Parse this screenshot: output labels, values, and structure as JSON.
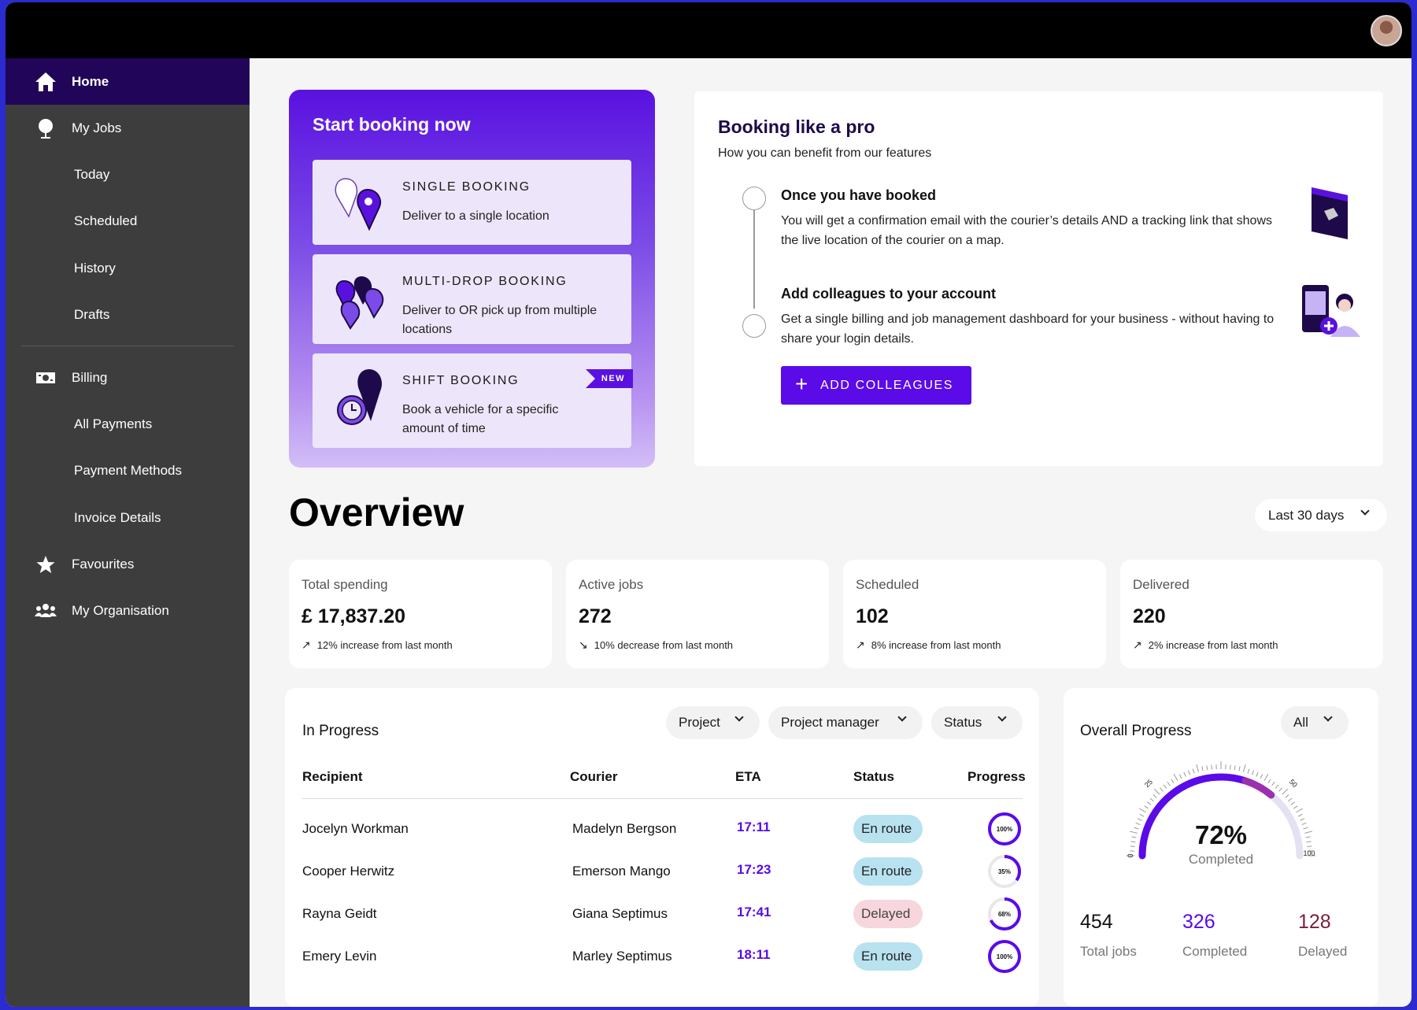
{
  "sidebar": {
    "items": [
      {
        "label": "Home",
        "icon": "home-icon"
      },
      {
        "label": "My Jobs",
        "icon": "map-pin-icon"
      },
      {
        "label": "Today"
      },
      {
        "label": "Scheduled"
      },
      {
        "label": "History"
      },
      {
        "label": "Drafts"
      },
      {
        "label": "Billing",
        "icon": "banknote-icon"
      },
      {
        "label": "All Payments"
      },
      {
        "label": "Payment Methods"
      },
      {
        "label": "Invoice Details"
      },
      {
        "label": "Favourites",
        "icon": "star-icon"
      },
      {
        "label": "My Organisation",
        "icon": "people-icon"
      }
    ]
  },
  "booking": {
    "title": "Start booking now",
    "options": [
      {
        "title": "SINGLE BOOKING",
        "desc": "Deliver to a single location"
      },
      {
        "title": "MULTI-DROP BOOKING",
        "desc": "Deliver to OR pick up from multiple locations"
      },
      {
        "title": "SHIFT BOOKING",
        "desc": "Book a vehicle for a specific amount of time",
        "badge": "NEW"
      }
    ]
  },
  "pro": {
    "title": "Booking like a pro",
    "subtitle": "How you can benefit from our features",
    "steps": [
      {
        "title": "Once you have booked",
        "desc": "You will get a confirmation email with the courier’s details AND a tracking link that shows the live location of the courier on a map."
      },
      {
        "title": "Add colleagues to your account",
        "desc": "Get a single billing and job management dashboard for your business - without having to share your login details."
      }
    ],
    "button": "ADD COLLEAGUES"
  },
  "overview": {
    "title": "Overview",
    "range": "Last 30 days",
    "stats": [
      {
        "label": "Total spending",
        "value": "£ 17,837.20",
        "trend": "12% increase from last month",
        "direction": "up"
      },
      {
        "label": "Active jobs",
        "value": "272",
        "trend": "10% decrease from last month",
        "direction": "down"
      },
      {
        "label": "Scheduled",
        "value": "102",
        "trend": "8% increase from last month",
        "direction": "up"
      },
      {
        "label": "Delivered",
        "value": "220",
        "trend": "2% increase from last month",
        "direction": "up"
      }
    ]
  },
  "in_progress": {
    "title": "In Progress",
    "filters": [
      "Project",
      "Project manager",
      "Status"
    ],
    "columns": [
      "Recipient",
      "Courier",
      "ETA",
      "Status",
      "Progress"
    ],
    "rows": [
      {
        "recipient": "Jocelyn Workman",
        "courier": "Madelyn Bergson",
        "eta": "17:11",
        "status": "En route",
        "progress": 100,
        "progress_label": "100%"
      },
      {
        "recipient": "Cooper Herwitz",
        "courier": "Emerson Mango",
        "eta": "17:23",
        "status": "En route",
        "progress": 35,
        "progress_label": "35%"
      },
      {
        "recipient": "Rayna Geidt",
        "courier": "Giana Septimus",
        "eta": "17:41",
        "status": "Delayed",
        "progress": 68,
        "progress_label": "68%"
      },
      {
        "recipient": "Emery Levin",
        "courier": "Marley Septimus",
        "eta": "18:11",
        "status": "En route",
        "progress": 100,
        "progress_label": "100%"
      }
    ]
  },
  "overall": {
    "title": "Overall Progress",
    "filter": "All",
    "percent": 72,
    "percent_label": "72%",
    "completed_label": "Completed",
    "ticks": [
      "0",
      "25",
      "50",
      "100"
    ],
    "totals": [
      {
        "value": "454",
        "label": "Total jobs",
        "color": "#111111"
      },
      {
        "value": "326",
        "label": "Completed",
        "color": "#5a0be8"
      },
      {
        "value": "128",
        "label": "Delayed",
        "color": "#7a1f3a"
      }
    ]
  },
  "colors": {
    "accent": "#5a0be8",
    "sidebar_active": "#200558",
    "sidebar_bg": "#3d3d3d"
  }
}
